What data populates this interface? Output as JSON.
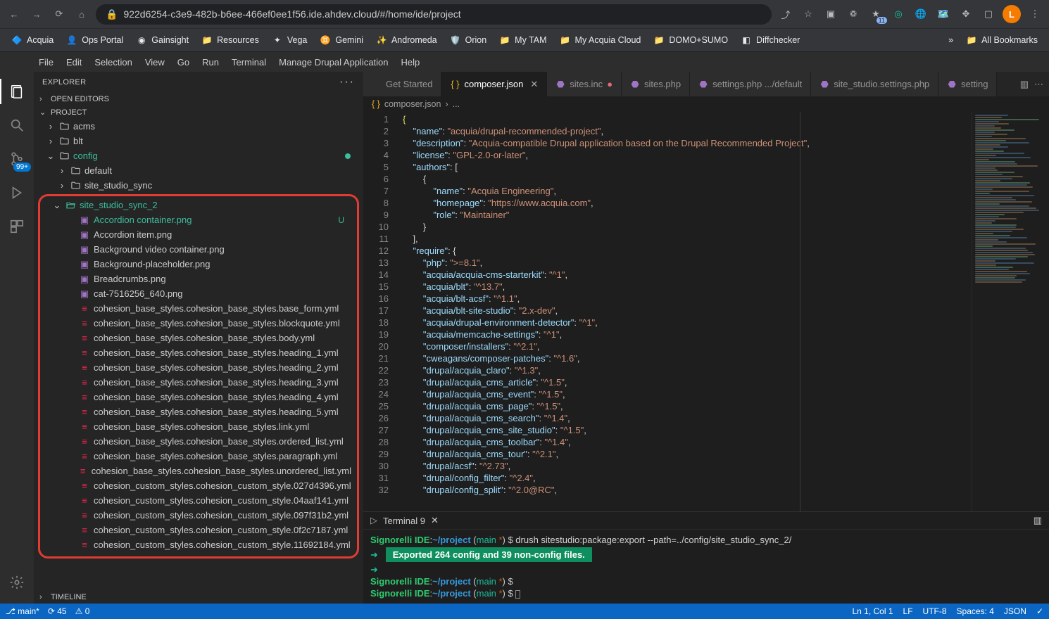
{
  "browser": {
    "url": "922d6254-c3e9-482b-b6ee-466ef0ee1f56.ide.ahdev.cloud/#/home/ide/project",
    "extensions_badge": "11",
    "avatar_letter": "L",
    "bookmarks": [
      {
        "label": "Acquia",
        "icon": "🔷"
      },
      {
        "label": "Ops Portal",
        "icon": "👤"
      },
      {
        "label": "Gainsight",
        "icon": "◉"
      },
      {
        "label": "Resources",
        "icon": "📁"
      },
      {
        "label": "Vega",
        "icon": "✦"
      },
      {
        "label": "Gemini",
        "icon": "♊"
      },
      {
        "label": "Andromeda",
        "icon": "✨"
      },
      {
        "label": "Orion",
        "icon": "🛡️"
      },
      {
        "label": "My TAM",
        "icon": "📁"
      },
      {
        "label": "My Acquia Cloud",
        "icon": "📁"
      },
      {
        "label": "DOMO+SUMO",
        "icon": "📁"
      },
      {
        "label": "Diffchecker",
        "icon": "◧"
      }
    ],
    "more": "»",
    "all_bookmarks": "All Bookmarks"
  },
  "menu": [
    "File",
    "Edit",
    "Selection",
    "View",
    "Go",
    "Run",
    "Terminal",
    "Manage Drupal Application",
    "Help"
  ],
  "activity": {
    "scm_badge": "99+"
  },
  "sidebar": {
    "title": "EXPLORER",
    "open_editors": "OPEN EDITORS",
    "project": "PROJECT",
    "timeline": "TIMELINE",
    "tree": {
      "top": [
        {
          "ind": 18,
          "chev": "›",
          "icon": "folder",
          "label": "acms"
        },
        {
          "ind": 18,
          "chev": "›",
          "icon": "folder",
          "label": "blt"
        },
        {
          "ind": 18,
          "chev": "⌄",
          "icon": "folder",
          "label": "config",
          "teal": true,
          "dot": true
        },
        {
          "ind": 34,
          "chev": "›",
          "icon": "folder",
          "label": "default"
        },
        {
          "ind": 34,
          "chev": "›",
          "icon": "folder",
          "label": "site_studio_sync"
        }
      ],
      "selected": {
        "ind": 18,
        "chev": "⌄",
        "icon": "folder-open",
        "label": "site_studio_sync_2",
        "teal": true
      },
      "highlighted": [
        {
          "label": "Accordion container.png",
          "icon": "img",
          "teal": true,
          "status": "U"
        },
        {
          "label": "Accordion item.png",
          "icon": "img"
        },
        {
          "label": "Background video container.png",
          "icon": "img"
        },
        {
          "label": "Background-placeholder.png",
          "icon": "img"
        },
        {
          "label": "Breadcrumbs.png",
          "icon": "img"
        },
        {
          "label": "cat-7516256_640.png",
          "icon": "img"
        },
        {
          "label": "cohesion_base_styles.cohesion_base_styles.base_form.yml",
          "icon": "yml"
        },
        {
          "label": "cohesion_base_styles.cohesion_base_styles.blockquote.yml",
          "icon": "yml"
        },
        {
          "label": "cohesion_base_styles.cohesion_base_styles.body.yml",
          "icon": "yml"
        },
        {
          "label": "cohesion_base_styles.cohesion_base_styles.heading_1.yml",
          "icon": "yml"
        },
        {
          "label": "cohesion_base_styles.cohesion_base_styles.heading_2.yml",
          "icon": "yml"
        },
        {
          "label": "cohesion_base_styles.cohesion_base_styles.heading_3.yml",
          "icon": "yml"
        },
        {
          "label": "cohesion_base_styles.cohesion_base_styles.heading_4.yml",
          "icon": "yml"
        },
        {
          "label": "cohesion_base_styles.cohesion_base_styles.heading_5.yml",
          "icon": "yml"
        },
        {
          "label": "cohesion_base_styles.cohesion_base_styles.link.yml",
          "icon": "yml"
        },
        {
          "label": "cohesion_base_styles.cohesion_base_styles.ordered_list.yml",
          "icon": "yml"
        },
        {
          "label": "cohesion_base_styles.cohesion_base_styles.paragraph.yml",
          "icon": "yml"
        },
        {
          "label": "cohesion_base_styles.cohesion_base_styles.unordered_list.yml",
          "icon": "yml"
        },
        {
          "label": "cohesion_custom_styles.cohesion_custom_style.027d4396.yml",
          "icon": "yml"
        },
        {
          "label": "cohesion_custom_styles.cohesion_custom_style.04aaf141.yml",
          "icon": "yml"
        },
        {
          "label": "cohesion_custom_styles.cohesion_custom_style.097f31b2.yml",
          "icon": "yml"
        },
        {
          "label": "cohesion_custom_styles.cohesion_custom_style.0f2c7187.yml",
          "icon": "yml"
        },
        {
          "label": "cohesion_custom_styles.cohesion_custom_style.11692184.yml",
          "icon": "yml"
        }
      ]
    }
  },
  "tabs": [
    {
      "label": "Get Started",
      "icon": "",
      "active": false
    },
    {
      "label": "composer.json",
      "icon": "json",
      "active": true,
      "close": true
    },
    {
      "label": "sites.inc",
      "icon": "php",
      "active": false,
      "mod": true
    },
    {
      "label": "sites.php",
      "icon": "php",
      "active": false
    },
    {
      "label": "settings.php .../default",
      "icon": "php",
      "active": false
    },
    {
      "label": "site_studio.settings.php",
      "icon": "php",
      "active": false
    },
    {
      "label": "setting",
      "icon": "php",
      "active": false
    }
  ],
  "breadcrumb": {
    "file": "composer.json",
    "sep": "›",
    "rest": "..."
  },
  "code": {
    "lines": [
      {
        "n": 1,
        "html": "<span class='b'>{</span>"
      },
      {
        "n": 2,
        "html": "    <span class='k'>\"name\"</span>: <span class='s'>\"acquia/drupal-recommended-project\"</span>,"
      },
      {
        "n": 3,
        "html": "    <span class='k'>\"description\"</span>: <span class='s'>\"Acquia-compatible Drupal application based on the Drupal Recommended Project\"</span>,"
      },
      {
        "n": 4,
        "html": "    <span class='k'>\"license\"</span>: <span class='s'>\"GPL-2.0-or-later\"</span>,"
      },
      {
        "n": 5,
        "html": "    <span class='k'>\"authors\"</span>: ["
      },
      {
        "n": 6,
        "html": "        {"
      },
      {
        "n": 7,
        "html": "            <span class='k'>\"name\"</span>: <span class='s'>\"Acquia Engineering\"</span>,"
      },
      {
        "n": 8,
        "html": "            <span class='k'>\"homepage\"</span>: <span class='s'>\"https://www.acquia.com\"</span>,"
      },
      {
        "n": 9,
        "html": "            <span class='k'>\"role\"</span>: <span class='s'>\"Maintainer\"</span>"
      },
      {
        "n": 10,
        "html": "        }"
      },
      {
        "n": 11,
        "html": "    ],"
      },
      {
        "n": 12,
        "html": "    <span class='k'>\"require\"</span>: {"
      },
      {
        "n": 13,
        "html": "        <span class='k'>\"php\"</span>: <span class='s'>\">=8.1\"</span>,"
      },
      {
        "n": 14,
        "html": "        <span class='k'>\"acquia/acquia-cms-starterkit\"</span>: <span class='s'>\"^1\"</span>,"
      },
      {
        "n": 15,
        "html": "        <span class='k'>\"acquia/blt\"</span>: <span class='s'>\"^13.7\"</span>,"
      },
      {
        "n": 16,
        "html": "        <span class='k'>\"acquia/blt-acsf\"</span>: <span class='s'>\"^1.1\"</span>,"
      },
      {
        "n": 17,
        "html": "        <span class='k'>\"acquia/blt-site-studio\"</span>: <span class='s'>\"2.x-dev\"</span>,"
      },
      {
        "n": 18,
        "html": "        <span class='k'>\"acquia/drupal-environment-detector\"</span>: <span class='s'>\"^1\"</span>,"
      },
      {
        "n": 19,
        "html": "        <span class='k'>\"acquia/memcache-settings\"</span>: <span class='s'>\"^1\"</span>,"
      },
      {
        "n": 20,
        "html": "        <span class='k'>\"composer/installers\"</span>: <span class='s'>\"^2.1\"</span>,"
      },
      {
        "n": 21,
        "html": "        <span class='k'>\"cweagans/composer-patches\"</span>: <span class='s'>\"^1.6\"</span>,"
      },
      {
        "n": 22,
        "html": "        <span class='k'>\"drupal/acquia_claro\"</span>: <span class='s'>\"^1.3\"</span>,"
      },
      {
        "n": 23,
        "html": "        <span class='k'>\"drupal/acquia_cms_article\"</span>: <span class='s'>\"^1.5\"</span>,"
      },
      {
        "n": 24,
        "html": "        <span class='k'>\"drupal/acquia_cms_event\"</span>: <span class='s'>\"^1.5\"</span>,"
      },
      {
        "n": 25,
        "html": "        <span class='k'>\"drupal/acquia_cms_page\"</span>: <span class='s'>\"^1.5\"</span>,"
      },
      {
        "n": 26,
        "html": "        <span class='k'>\"drupal/acquia_cms_search\"</span>: <span class='s'>\"^1.4\"</span>,"
      },
      {
        "n": 27,
        "html": "        <span class='k'>\"drupal/acquia_cms_site_studio\"</span>: <span class='s'>\"^1.5\"</span>,"
      },
      {
        "n": 28,
        "html": "        <span class='k'>\"drupal/acquia_cms_toolbar\"</span>: <span class='s'>\"^1.4\"</span>,"
      },
      {
        "n": 29,
        "html": "        <span class='k'>\"drupal/acquia_cms_tour\"</span>: <span class='s'>\"^2.1\"</span>,"
      },
      {
        "n": 30,
        "html": "        <span class='k'>\"drupal/acsf\"</span>: <span class='s'>\"^2.73\"</span>,"
      },
      {
        "n": 31,
        "html": "        <span class='k'>\"drupal/config_filter\"</span>: <span class='s'>\"^2.4\"</span>,"
      },
      {
        "n": 32,
        "html": "        <span class='k'>\"drupal/config_split\"</span>: <span class='s'>\"^2.0@RC\"</span>,"
      }
    ]
  },
  "terminal": {
    "title": "Terminal 9",
    "prompt_user": "Signorelli IDE",
    "prompt_path": "~/project",
    "branch": "main",
    "cmd": "drush sitestudio:package:export --path=../config/site_studio_sync_2/",
    "exported": "Exported 264 config and 39 non-config files.",
    "arrow": "➜"
  },
  "statusbar": {
    "branch": "main*",
    "sync": "⟳ 45",
    "warn": "⚠ 0",
    "right": [
      "Ln 1, Col 1",
      "LF",
      "UTF-8",
      "Spaces: 4",
      "JSON",
      "✓"
    ]
  }
}
